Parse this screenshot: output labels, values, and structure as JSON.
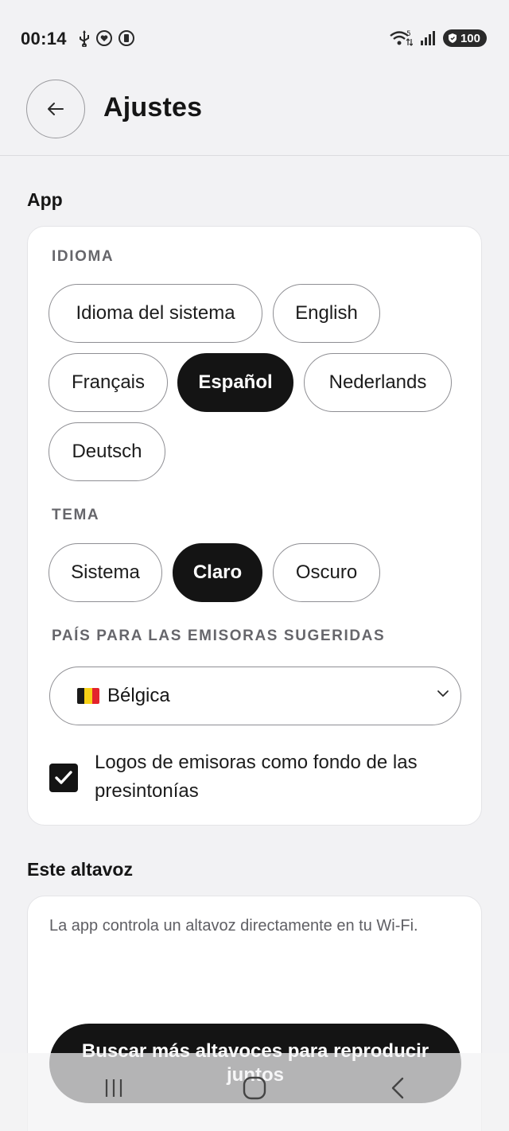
{
  "status_bar": {
    "time": "00:14",
    "battery": "100",
    "icons": [
      "usb-icon",
      "heart-status-icon",
      "battery-saver-icon",
      "wifi-icon",
      "signal-icon",
      "shield-icon"
    ]
  },
  "header": {
    "back_icon": "arrow-left-icon",
    "title": "Ajustes"
  },
  "app_section": {
    "heading": "App",
    "language": {
      "label": "IDIOMA",
      "options": [
        "Idioma del sistema",
        "English",
        "Français",
        "Español",
        "Nederlands",
        "Deutsch"
      ],
      "selected": "Español"
    },
    "theme": {
      "label": "TEMA",
      "options": [
        "Sistema",
        "Claro",
        "Oscuro"
      ],
      "selected": "Claro"
    },
    "country": {
      "label": "PAÍS PARA LAS EMISORAS SUGERIDAS",
      "selected": "Bélgica",
      "flag_colors": [
        "#1a1a1a",
        "#f7d117",
        "#e3232c"
      ]
    },
    "logos_checkbox": {
      "label": "Logos de emisoras como fondo de las presintonías",
      "checked": true
    }
  },
  "speaker_section": {
    "heading": "Este altavoz",
    "description": "La app controla un altavoz directamente en tu Wi-Fi.",
    "button_label": "Buscar más altavoces para reproducir juntos"
  },
  "nav": {
    "icons": [
      "recents-icon",
      "home-icon",
      "back-icon"
    ]
  }
}
